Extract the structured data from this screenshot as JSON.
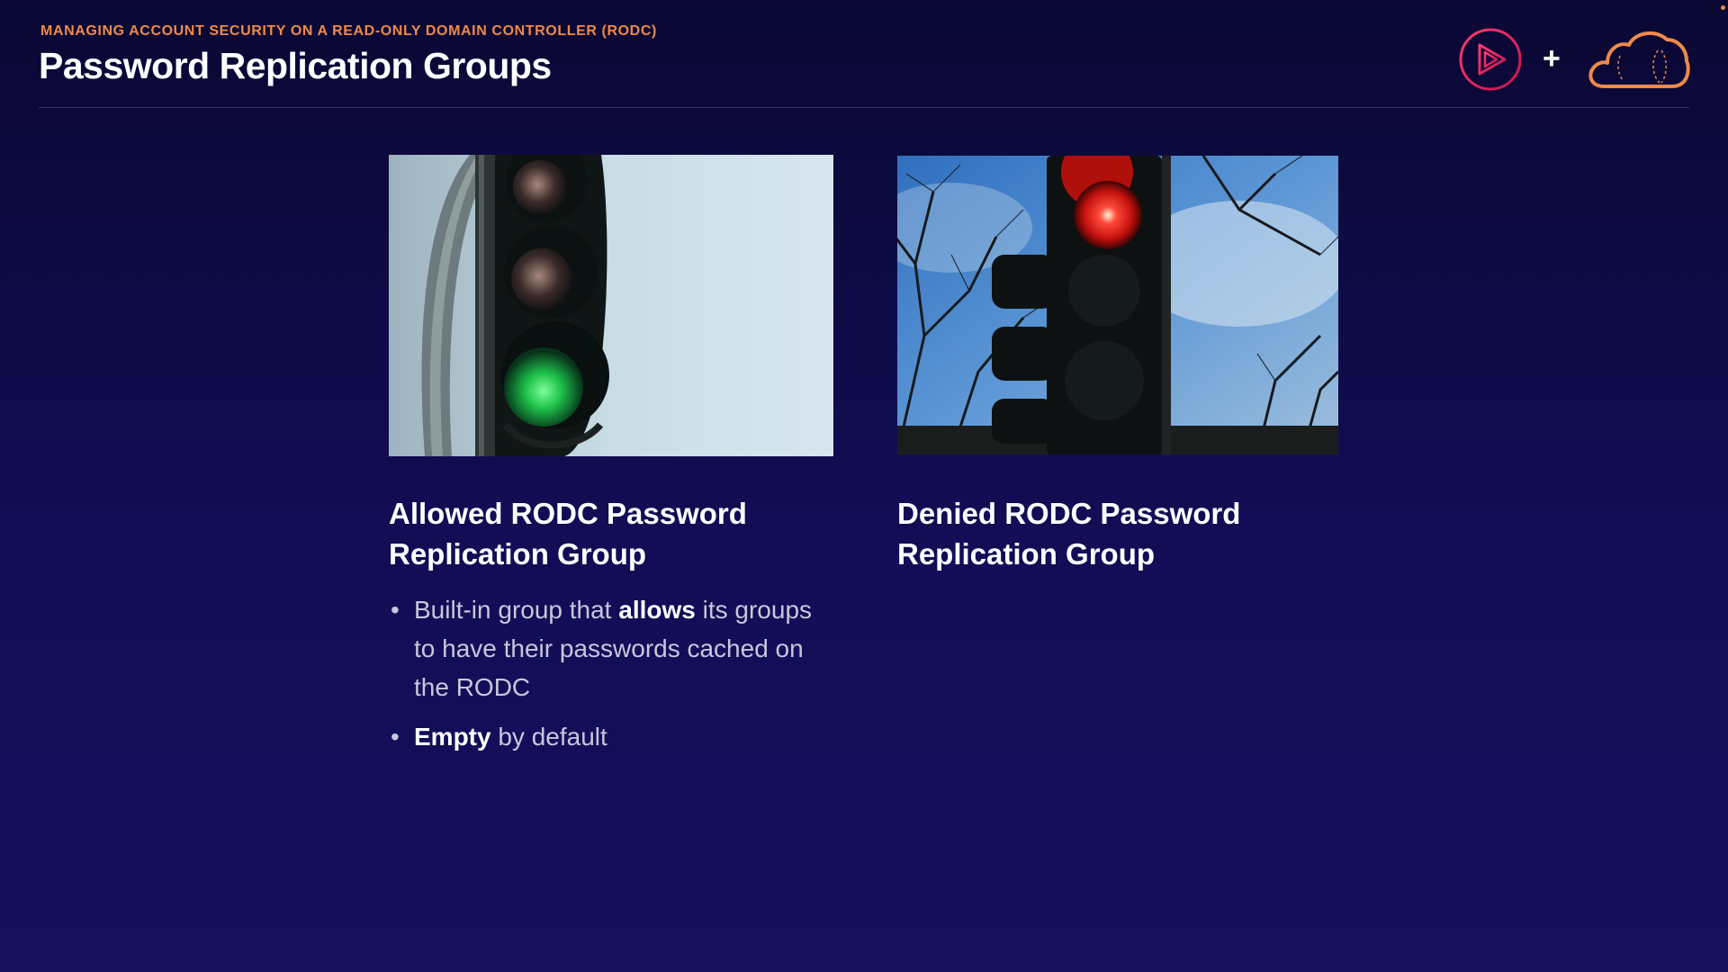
{
  "header": {
    "eyebrow": "MANAGING ACCOUNT SECURITY ON A READ-ONLY DOMAIN CONTROLLER (RODC)",
    "title": "Password Replication Groups",
    "plus": "+"
  },
  "left_column": {
    "title": "Allowed RODC Password Replication Group",
    "bullets": [
      {
        "pre": "Built-in group that ",
        "bold": "allows",
        "post": " its groups to have their passwords cached on the RODC"
      },
      {
        "pre": "",
        "bold": "Empty",
        "post": " by default"
      }
    ]
  },
  "right_column": {
    "title": "Denied RODC Password Replication Group"
  },
  "colors": {
    "accent": "#f0894a",
    "background": "#0a0833",
    "logo_play": "#e0245e",
    "logo_cloud": "#f0894a"
  },
  "icons": [
    "play-logo-icon",
    "plus-icon",
    "cloud-logo-icon",
    "bullet-icon"
  ]
}
